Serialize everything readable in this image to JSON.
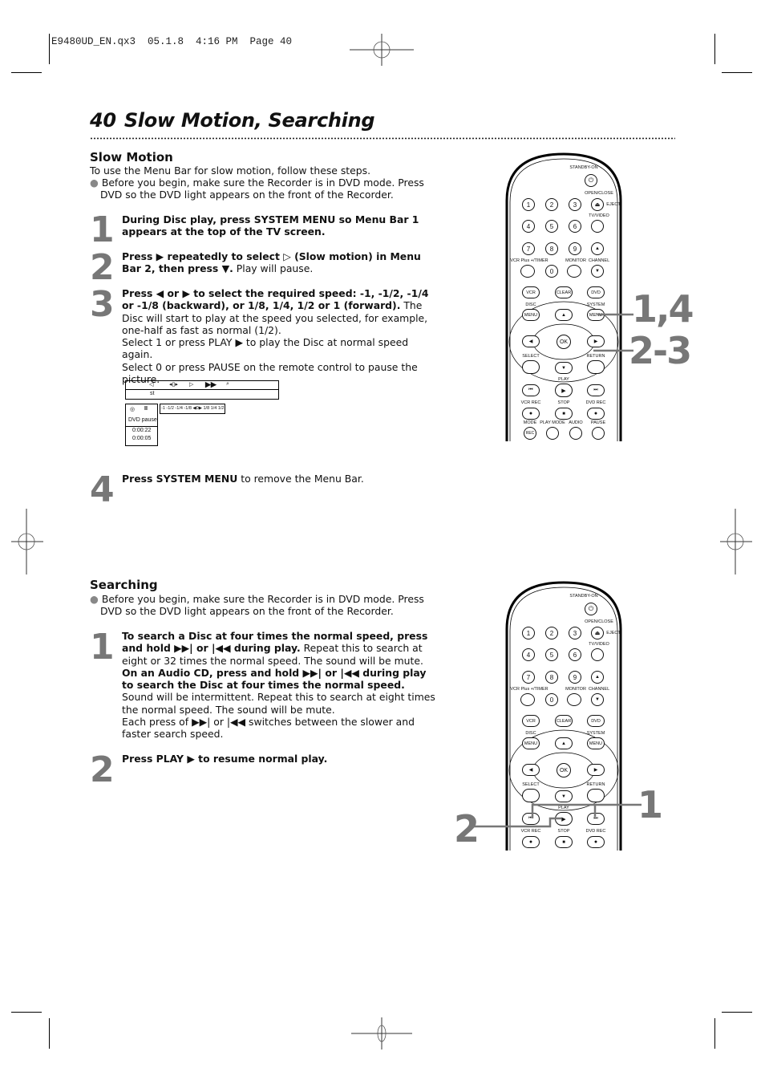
{
  "slug": "E9480UD_EN.qx3  05.1.8  4:16 PM  Page 40",
  "page": {
    "number": "40",
    "title": "Slow Motion, Searching"
  },
  "slow_motion": {
    "heading": "Slow Motion",
    "intro": "To use the Menu Bar for slow motion, follow these steps.",
    "bullet": "Before you begin, make sure the Recorder is in DVD mode. Press DVD so the DVD light appears on the front of the Recorder.",
    "steps": [
      {
        "num": "1",
        "bold": "During Disc play, press SYSTEM MENU so Menu Bar 1 appears at the top of the TV screen.",
        "normal": ""
      },
      {
        "num": "2",
        "bold": "Press ▶ repeatedly to select ▷ (Slow motion) in Menu Bar 2, then press ▼.",
        "normal": " Play will pause."
      },
      {
        "num": "3",
        "bold": "Press ◀ or ▶ to select the required speed: -1, -1/2, -1/4 or -1/8 (backward), or 1/8, 1/4, 1/2 or 1 (forward).",
        "normal": " The Disc will start to play at the speed you selected, for example, one-half as fast as normal (1/2).",
        "extra1": "Select 1 or press PLAY ▶ to play the Disc at normal speed again.",
        "extra2": "Select 0 or press PAUSE on the remote control to pause the picture."
      },
      {
        "num": "4",
        "bold": "Press SYSTEM MENU",
        "normal": " to remove the Menu Bar."
      }
    ],
    "osd": {
      "menubar_label": "st",
      "speed_scale": "-1 -1/2 -1/4 -1/8 ◀0▶ 1/8  1/4  1/2  1",
      "status_mode": "DVD pause",
      "time_total": "0:00:22",
      "time_chapter": "0:00:05",
      "pause_glyph": "II"
    },
    "callout_top": "1,4",
    "callout_bottom": "2-3"
  },
  "searching": {
    "heading": "Searching",
    "bullet": "Before you begin, make sure the Recorder is in DVD mode. Press DVD so the DVD light appears on the front of the Recorder.",
    "steps": [
      {
        "num": "1",
        "bold": "To search a Disc at four times the normal speed, press and hold ▶▶| or |◀◀ during play.",
        "normal": " Repeat this to search at eight or 32 times the normal speed. The sound will be mute.",
        "bold2": "On an Audio CD, press and hold ▶▶| or |◀◀ during play to search the Disc at four times the normal speed.",
        "normal2": " Sound will be intermittent. Repeat this to search at eight times the normal speed. The sound will be mute.",
        "extra": "Each press of ▶▶| or |◀◀ switches between the slower and faster search speed."
      },
      {
        "num": "2",
        "bold": "Press PLAY ▶ to resume normal play.",
        "normal": ""
      }
    ],
    "callout_right": "1",
    "callout_left": "2"
  },
  "remote": {
    "standby": "STANDBY-ON",
    "open_close": "OPEN/CLOSE",
    "eject": "EJECT",
    "tv_video": "TV/VIDEO",
    "digits": [
      "1",
      "2",
      "3",
      "4",
      "5",
      "6",
      "7",
      "8",
      "9",
      "0"
    ],
    "vcr_plus": "VCR Plus +/TIMER",
    "monitor": "MONITOR",
    "channel": "CHANNEL",
    "vcr": "VCR",
    "clear": "CLEAR",
    "dvd": "DVD",
    "disc": "DISC",
    "system": "SYSTEM",
    "menu": "MENU",
    "ok": "OK",
    "select": "SELECT",
    "return": "RETURN",
    "play": "PLAY",
    "vcr_rec": "VCR REC",
    "stop": "STOP",
    "dvd_rec": "DVD REC",
    "mode": "MODE",
    "play_mode": "PLAY MODE",
    "audio": "AUDIO",
    "pause": "PAUSE",
    "rec": "REC"
  }
}
